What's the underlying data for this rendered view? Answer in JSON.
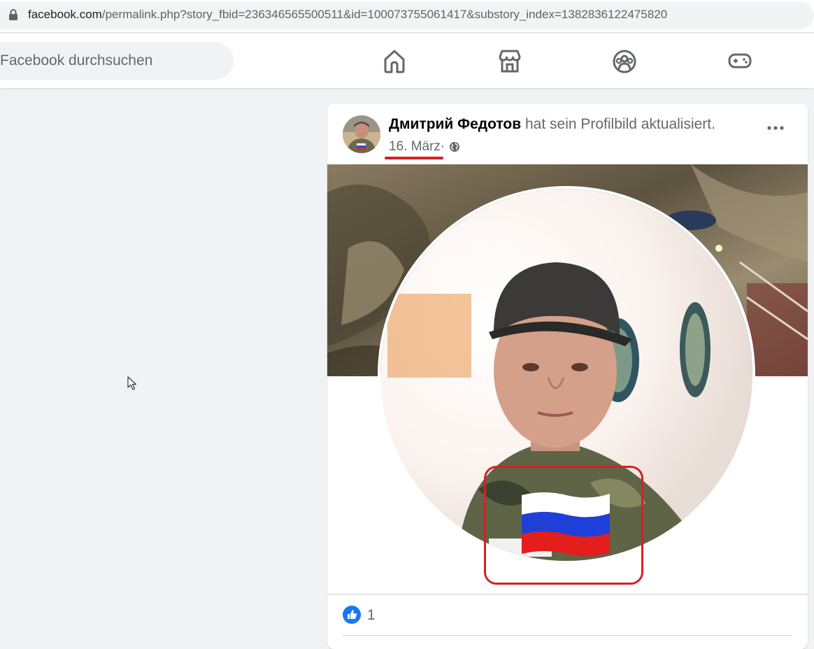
{
  "browser": {
    "url_host": "facebook.com",
    "url_rest": "/permalink.php?story_fbid=236346565500511&id=100073755061417&substory_index=1382836122475820"
  },
  "header": {
    "search_placeholder": "Facebook durchsuchen",
    "nav": [
      "home-icon",
      "marketplace-icon",
      "groups-icon",
      "gaming-icon"
    ]
  },
  "post": {
    "author": "Дмитрий Федотов",
    "action": " hat sein Profilbild aktualisiert.",
    "date": "16. März",
    "separator": " · ",
    "privacy_icon": "globe-icon",
    "likes": "1"
  },
  "colors": {
    "accent": "#1877f2",
    "annotation": "#d91f26"
  }
}
